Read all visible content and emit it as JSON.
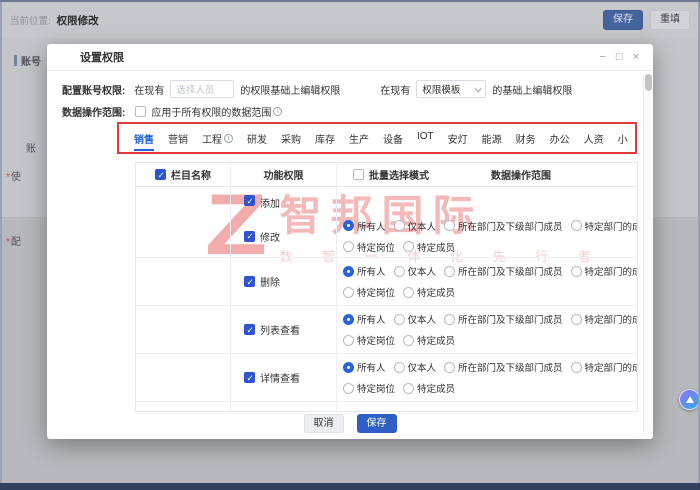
{
  "page": {
    "topbar": {
      "breadcrumb_label": "当前位置:",
      "breadcrumb_current": "权限修改",
      "save_button": "保存",
      "refill_button": "重填"
    },
    "background": {
      "section_title": "账号",
      "fragment_field": "账",
      "fragment_required_1": "使",
      "fragment_required_2": "配",
      "required_mark": "*"
    }
  },
  "modal": {
    "title": "设置权限",
    "window_controls": {
      "minimize": "−",
      "maximize": "□",
      "close": "×"
    },
    "config_row": {
      "label": "配置账号权限:",
      "prefix1": "在现有",
      "person_placeholder": "选择人员",
      "suffix1": "的权限基础上编辑权限",
      "prefix2": "在现有",
      "template_value": "权限模板",
      "suffix2": "的基础上编辑权限"
    },
    "scope_row": {
      "label": "数据操作范围:",
      "checkbox_label": "应用于所有权限的数据范围",
      "checked": false
    },
    "tabs": [
      {
        "label": "销售",
        "active": true
      },
      {
        "label": "营销"
      },
      {
        "label": "工程",
        "info": true
      },
      {
        "label": "研发"
      },
      {
        "label": "采购"
      },
      {
        "label": "库存"
      },
      {
        "label": "生产"
      },
      {
        "label": "设备"
      },
      {
        "label": "IOT"
      },
      {
        "label": "安灯"
      },
      {
        "label": "能源"
      },
      {
        "label": "财务"
      },
      {
        "label": "办公"
      },
      {
        "label": "人资"
      },
      {
        "label": "小"
      }
    ],
    "table": {
      "header": {
        "col1": "栏目名称",
        "col1_checked": true,
        "col2": "功能权限",
        "col3_batch": "批量选择模式",
        "col3_batch_checked": false,
        "col3_scope": "数据操作范围"
      },
      "radio_options_line1": [
        "所有人",
        "仅本人",
        "所在部门及下级部门成员",
        "特定部门的成员"
      ],
      "radio_options_line2": [
        "特定岗位",
        "特定成员"
      ],
      "rows": [
        {
          "permission": "添加",
          "checked": true,
          "has_scope": false,
          "selected": null
        },
        {
          "permission": "修改",
          "checked": true,
          "has_scope": true,
          "selected": "所有人"
        },
        {
          "permission": "删除",
          "checked": true,
          "has_scope": true,
          "selected": "所有人"
        },
        {
          "permission": "列表查看",
          "checked": true,
          "has_scope": true,
          "selected": "所有人"
        },
        {
          "permission": "详情查看",
          "checked": true,
          "has_scope": true,
          "selected": "所有人"
        }
      ]
    },
    "footer": {
      "cancel": "取消",
      "save": "保存"
    }
  },
  "watermark": {
    "logo": "Z",
    "brand": "智邦国际",
    "slogan": "数 智 一 体 化 先 行 者"
  },
  "colors": {
    "accent_blue": "#2a62d9",
    "annotation_red": "#e23a3a",
    "watermark_pink": "#ec8080",
    "save_blue": "#2f5fc4"
  }
}
